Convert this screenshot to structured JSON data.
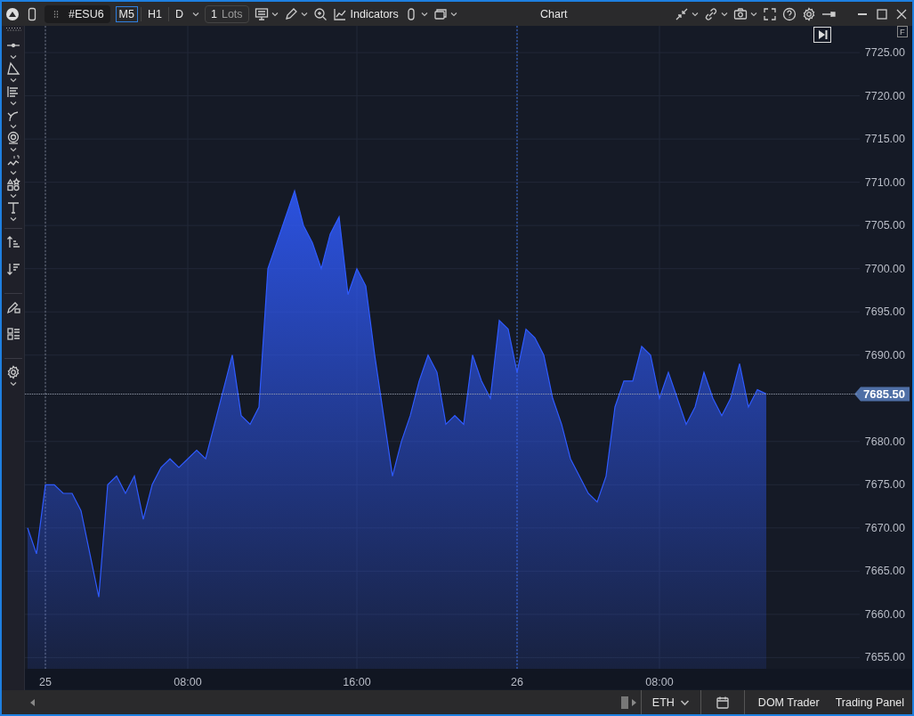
{
  "titlebar": {
    "symbol": "#ESU6",
    "timeframes": [
      {
        "label": "M5",
        "selected": true
      },
      {
        "label": "H1",
        "selected": false
      },
      {
        "label": "D",
        "selected": false
      }
    ],
    "lots": {
      "value": "1",
      "unit": "Lots"
    },
    "indicators": "Indicators",
    "title": "Chart"
  },
  "chart": {
    "badge": "F",
    "current_price": "7685.50",
    "chart_data": {
      "type": "area",
      "grid": true,
      "ylim": [
        7653.7,
        7728.1
      ],
      "categories": [
        null,
        null,
        "25",
        null,
        null,
        null,
        null,
        null,
        null,
        null,
        null,
        null,
        null,
        null,
        null,
        null,
        null,
        null,
        "08:00",
        null,
        null,
        null,
        null,
        null,
        null,
        null,
        null,
        null,
        null,
        null,
        null,
        null,
        null,
        null,
        null,
        null,
        null,
        "16:00",
        null,
        null,
        null,
        null,
        null,
        null,
        null,
        null,
        null,
        null,
        null,
        null,
        null,
        null,
        null,
        null,
        null,
        "26",
        null,
        null,
        null,
        null,
        null,
        null,
        null,
        null,
        null,
        null,
        null,
        null,
        null,
        null,
        null,
        "08:00",
        null,
        null,
        null,
        null,
        null,
        null,
        null,
        null,
        null,
        null,
        null,
        null
      ],
      "yticks": [
        {
          "value": 7725,
          "label": "7725.00"
        },
        {
          "value": 7720,
          "label": "7720.00"
        },
        {
          "value": 7715,
          "label": "7715.00"
        },
        {
          "value": 7710,
          "label": "7710.00"
        },
        {
          "value": 7705,
          "label": "7705.00"
        },
        {
          "value": 7700,
          "label": "7700.00"
        },
        {
          "value": 7695,
          "label": "7695.00"
        },
        {
          "value": 7690,
          "label": "7690.00"
        },
        {
          "value": 7680,
          "label": "7680.00"
        },
        {
          "value": 7675,
          "label": "7675.00"
        },
        {
          "value": 7670,
          "label": "7670.00"
        },
        {
          "value": 7665,
          "label": "7665.00"
        },
        {
          "value": 7660,
          "label": "7660.00"
        },
        {
          "value": 7655,
          "label": "7655.00"
        }
      ],
      "series": [
        {
          "color": "#2f5bff",
          "values": [
            7670,
            7667,
            7675,
            7675,
            7674,
            7674,
            7672,
            7667,
            7662,
            7675,
            7676,
            7674,
            7676,
            7671,
            7675,
            7677,
            7678,
            7677,
            7678,
            7679,
            7678,
            7682,
            7686,
            7690,
            7683,
            7682,
            7684,
            7700,
            7703,
            7706,
            7709,
            7705,
            7703,
            7700,
            7704,
            7706,
            7697,
            7700,
            7698,
            7690,
            7683,
            7676,
            7680,
            7683,
            7687,
            7690,
            7688,
            7682,
            7683,
            7682,
            7690,
            7687,
            7685,
            7694,
            7693,
            7688,
            7693,
            7692,
            7690,
            7685,
            7682,
            7678,
            7676,
            7674,
            7673,
            7676,
            7684,
            7687,
            7687,
            7691,
            7690,
            7685,
            7688,
            7685,
            7682,
            7684,
            7688,
            7685,
            7683,
            7685,
            7689,
            7684,
            7686,
            7685.5
          ]
        }
      ]
    }
  },
  "status_bar": {
    "session": "ETH",
    "buttons": [
      "DOM Trader",
      "Trading Panel"
    ]
  }
}
